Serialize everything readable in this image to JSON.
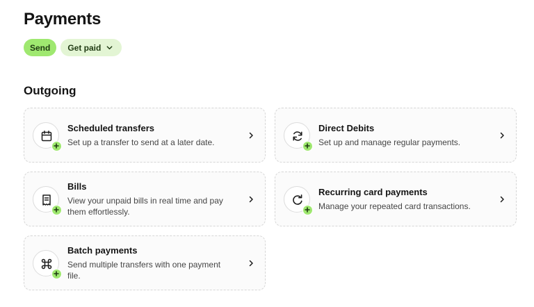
{
  "header": {
    "title": "Payments"
  },
  "tabs": {
    "send": "Send",
    "get_paid": "Get paid"
  },
  "section": {
    "title": "Outgoing"
  },
  "cards": {
    "scheduled": {
      "title": "Scheduled transfers",
      "desc": "Set up a transfer to send at a later date.",
      "icon": "calendar-icon"
    },
    "direct_debits": {
      "title": "Direct Debits",
      "desc": "Set up and manage regular payments.",
      "icon": "refresh-icon"
    },
    "bills": {
      "title": "Bills",
      "desc": "View your unpaid bills in real time and pay them effortlessly.",
      "icon": "receipt-icon"
    },
    "recurring": {
      "title": "Recurring card payments",
      "desc": "Manage your repeated card transactions.",
      "icon": "repeat-icon"
    },
    "batch": {
      "title": "Batch payments",
      "desc": "Send multiple transfers with one payment file.",
      "icon": "command-icon"
    }
  },
  "colors": {
    "accent": "#9fe870",
    "accent_light": "#e3f5d4",
    "card_border": "#d6d6d6"
  }
}
